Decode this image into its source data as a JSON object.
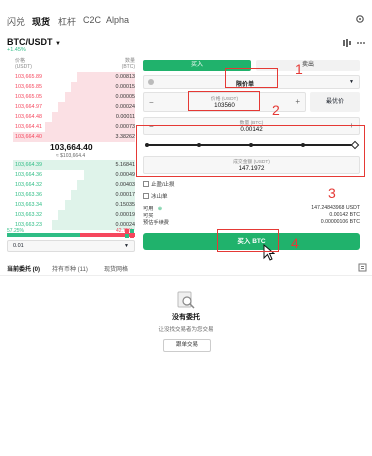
{
  "nav": {
    "tabs": [
      "闪兑",
      "现货",
      "杠杆",
      "C2C",
      "Alpha"
    ],
    "active": "现货"
  },
  "pair": {
    "symbol": "BTC/USDT",
    "change": "+1.45%"
  },
  "orderbook": {
    "col_price": "价格",
    "col_price_unit": "(USDT)",
    "col_amount": "数量",
    "col_amount_unit": "(BTC)",
    "asks": [
      {
        "price": "103,665.89",
        "qty": "0.00813",
        "depth": 0.45
      },
      {
        "price": "103,665.85",
        "qty": "0.00015",
        "depth": 0.5
      },
      {
        "price": "103,665.05",
        "qty": "0.00005",
        "depth": 0.55
      },
      {
        "price": "103,664.97",
        "qty": "0.00024",
        "depth": 0.6
      },
      {
        "price": "103,664.48",
        "qty": "0.00011",
        "depth": 0.65
      },
      {
        "price": "103,664.41",
        "qty": "0.00073",
        "depth": 0.7
      },
      {
        "price": "103,664.40",
        "qty": "3.38262",
        "depth": 0.95
      }
    ],
    "mid_price": "103,664.40",
    "mid_usd": "≈ $103,664.4",
    "bids": [
      {
        "price": "103,664.39",
        "qty": "5.16841",
        "depth": 0.95
      },
      {
        "price": "103,664.36",
        "qty": "0.00049",
        "depth": 0.4
      },
      {
        "price": "103,664.32",
        "qty": "0.00403",
        "depth": 0.45
      },
      {
        "price": "103,663.36",
        "qty": "0.00017",
        "depth": 0.5
      },
      {
        "price": "103,663.34",
        "qty": "0.15035",
        "depth": 0.55
      },
      {
        "price": "103,663.32",
        "qty": "0.00019",
        "depth": 0.6
      },
      {
        "price": "103,663.23",
        "qty": "0.00024",
        "depth": 0.65
      }
    ],
    "buy_ratio_label": "57.25%",
    "sell_ratio_label": "42.75%",
    "buy_ratio": 0.5725,
    "precision": "0.01"
  },
  "form": {
    "buy_tab": "买入",
    "sell_tab": "卖出",
    "order_type": "限价单",
    "price_label": "价格 (USDT)",
    "price_value": "103560",
    "best_price_btn": "最优价",
    "amount_label": "数量 (BTC)",
    "amount_value": "0.00142",
    "total_label": "成交金额 (USDT)",
    "total_value": "147.1972",
    "take_profit": "止盈/止损",
    "iceberg": "冰山单",
    "available_label": "可用",
    "available_value": "147.24843968 USDT",
    "can_buy_label": "可买",
    "can_buy_value": "0.00142 BTC",
    "fee_label": "预估手续费",
    "fee_value": "0.00000106 BTC",
    "buy_button": "买入 BTC"
  },
  "annotations": [
    "1",
    "2",
    "3",
    "4"
  ],
  "bottom": {
    "tabs": [
      "当前委托 (0)",
      "持有币种 (11)",
      "现货网格"
    ],
    "empty_title": "没有委托",
    "empty_sub": "让没找交易者为您交易",
    "empty_btn": "跟单交易"
  },
  "colors": {
    "buy": "#20b26c",
    "sell": "#f6465d",
    "annotation": "#e53935"
  }
}
